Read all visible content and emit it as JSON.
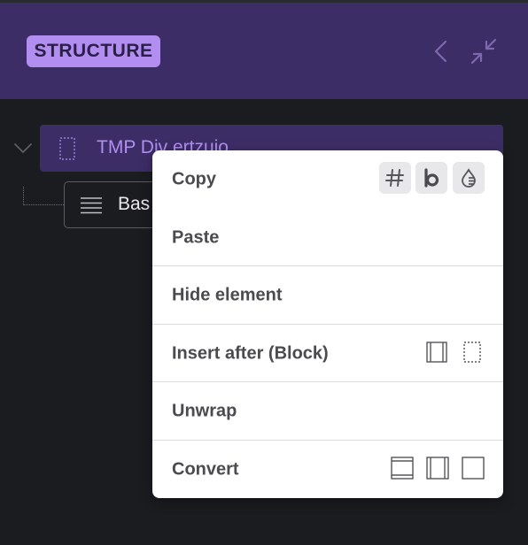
{
  "header": {
    "badge": "STRUCTURE",
    "icons": [
      "chevron-left-icon",
      "collapse-icon"
    ]
  },
  "tree": {
    "items": [
      {
        "label": "TMP Div ertzuio",
        "icon": "div-dotted-icon",
        "selected": true
      },
      {
        "label": "Bas",
        "icon": "text-lines-icon",
        "selected": false
      }
    ]
  },
  "context_menu": {
    "copy_label": "Copy",
    "copy_actions": [
      "hash-icon",
      "bold-b-icon",
      "droplet-icon"
    ],
    "paste_label": "Paste",
    "hide_label": "Hide element",
    "insert_after_label": "Insert after (Block)",
    "insert_after_icons": [
      "block-icon",
      "div-dotted-icon"
    ],
    "unwrap_label": "Unwrap",
    "convert_label": "Convert",
    "convert_icons": [
      "section-icon",
      "block-icon",
      "container-icon"
    ]
  },
  "colors": {
    "header_bg": "#3d2d66",
    "accent": "#b18ef0",
    "panel_bg": "#1b1c20",
    "menu_text": "#4a4a4f"
  }
}
